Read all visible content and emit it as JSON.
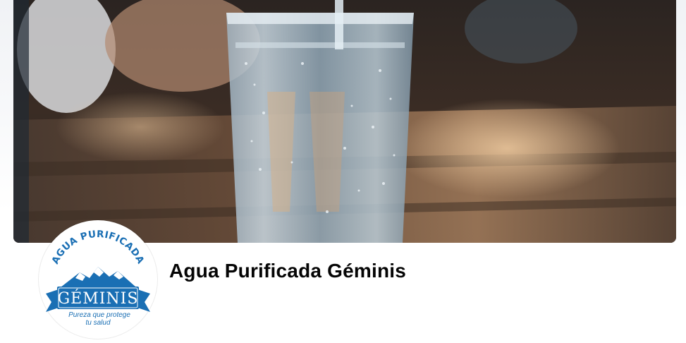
{
  "page": {
    "title": "Agua Purificada Géminis"
  },
  "cover": {
    "image": "water-glass-photo"
  },
  "profile": {
    "image": "geminis-logo",
    "logo": {
      "top_text": "AGUA PURIFICADA",
      "brand": "GÉMINIS",
      "tagline_line1": "Pureza que protege",
      "tagline_line2": "tu salud"
    }
  },
  "colors": {
    "logo_blue": "#1a6fb4",
    "title_text": "#050505"
  }
}
